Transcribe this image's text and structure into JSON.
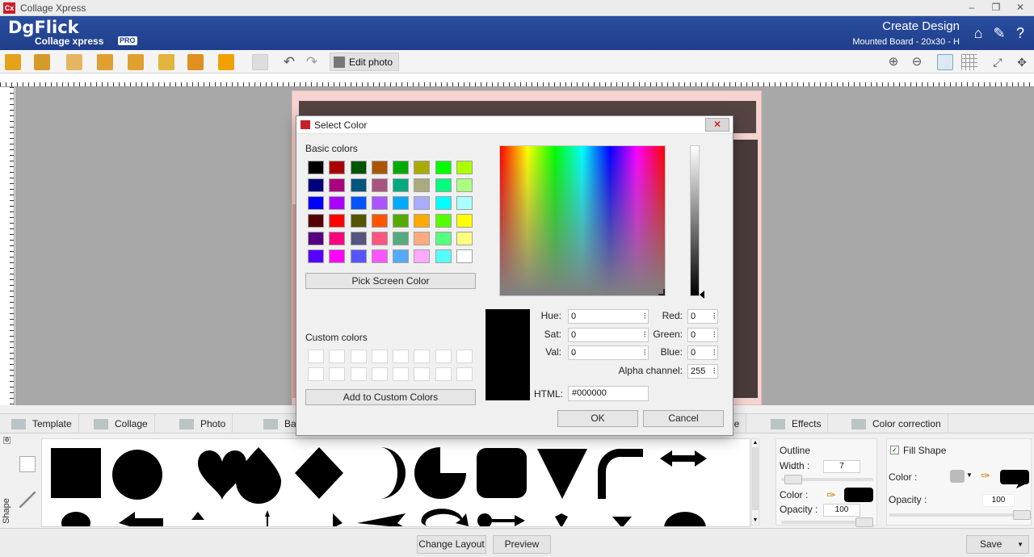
{
  "window": {
    "title": "Collage Xpress",
    "app_icon": "Cx"
  },
  "header": {
    "logo_main": "DgFlick",
    "logo_sub": "Collage xpress",
    "logo_badge": "PRO",
    "title": "Create Design",
    "subtitle": "Mounted Board - 20x30 - H"
  },
  "toolbar": {
    "edit_photo": "Edit photo"
  },
  "tabs": [
    {
      "label": "Template"
    },
    {
      "label": "Collage"
    },
    {
      "label": "Photo"
    },
    {
      "label": "Ba"
    },
    {
      "label": "le"
    },
    {
      "label": "Effects"
    },
    {
      "label": "Color correction"
    }
  ],
  "side": {
    "shape_label": "Shape"
  },
  "outline": {
    "title": "Outline",
    "width_label": "Width :",
    "width_value": "7",
    "color_label": "Color :",
    "opacity_label": "Opacity :",
    "opacity_value": "100",
    "color": "#000000"
  },
  "fill": {
    "title": "Fill Shape",
    "color_label": "Color :",
    "opacity_label": "Opacity :",
    "opacity_value": "100",
    "color": "#000000"
  },
  "footer": {
    "change_layout": "Change Layout",
    "preview": "Preview",
    "save": "Save"
  },
  "dialog": {
    "title": "Select Color",
    "basic_colors_label": "Basic colors",
    "basic_colors": [
      "#000000",
      "#aa0000",
      "#005500",
      "#aa5500",
      "#00aa00",
      "#aaaa00",
      "#00ff00",
      "#aaff00",
      "#00007f",
      "#aa007f",
      "#00557f",
      "#aa557f",
      "#00aa7f",
      "#aaaa7f",
      "#00ff7f",
      "#aaff7f",
      "#0000ff",
      "#aa00ff",
      "#0055ff",
      "#aa55ff",
      "#00aaff",
      "#aaaaff",
      "#00ffff",
      "#aaffff",
      "#550000",
      "#ff0000",
      "#555500",
      "#ff5500",
      "#55aa00",
      "#ffaa00",
      "#55ff00",
      "#ffff00",
      "#55007f",
      "#ff007f",
      "#55557f",
      "#ff557f",
      "#55aa7f",
      "#ffaa7f",
      "#55ff7f",
      "#ffff7f",
      "#5500ff",
      "#ff00ff",
      "#5555ff",
      "#ff55ff",
      "#55aaff",
      "#ffaaff",
      "#55ffff",
      "#ffffff"
    ],
    "pick_screen_color": "Pick Screen Color",
    "custom_colors_label": "Custom colors",
    "add_custom": "Add to Custom Colors",
    "hue_label": "Hue:",
    "hue": "0",
    "sat_label": "Sat:",
    "sat": "0",
    "val_label": "Val:",
    "val": "0",
    "red_label": "Red:",
    "red": "0",
    "green_label": "Green:",
    "green": "0",
    "blue_label": "Blue:",
    "blue": "0",
    "alpha_label": "Alpha channel:",
    "alpha": "255",
    "html_label": "HTML:",
    "html": "#000000",
    "ok": "OK",
    "cancel": "Cancel"
  }
}
